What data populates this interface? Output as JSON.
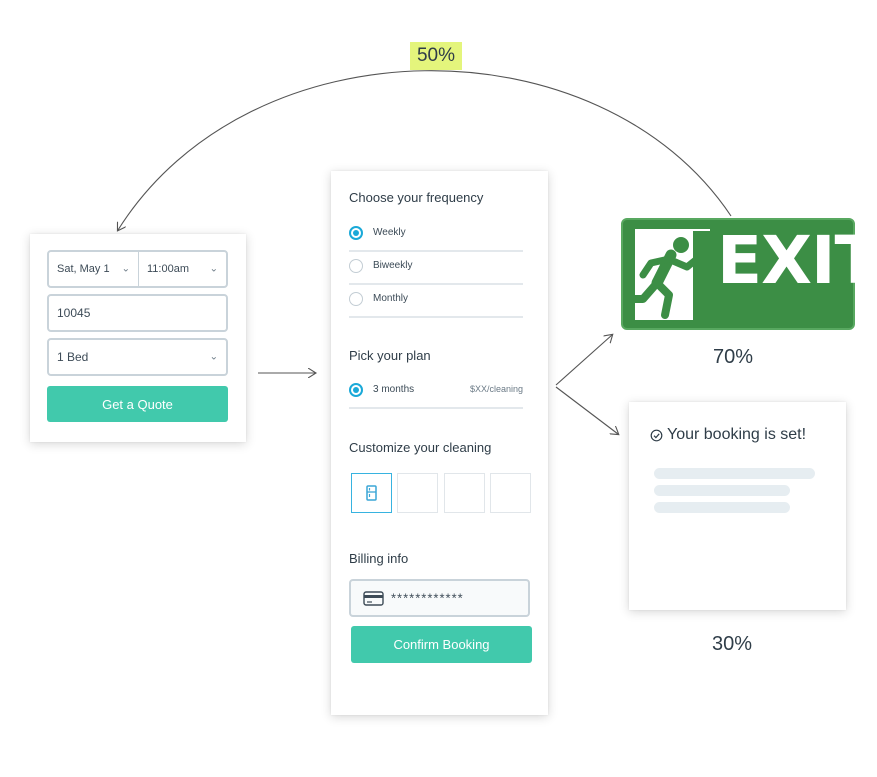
{
  "quote_form": {
    "date": "Sat, May 1",
    "time": "11:00am",
    "zip": "10045",
    "bedrooms": "1 Bed",
    "quote_button": "Get a Quote"
  },
  "booking_form": {
    "frequency_title": "Choose your frequency",
    "frequency_options": [
      "Weekly",
      "Biweekly",
      "Monthly"
    ],
    "selected_frequency": "Weekly",
    "plan_title": "Pick your plan",
    "plan_option": "3 months",
    "plan_price": "$XX/cleaning",
    "customize_title": "Customize your cleaning",
    "billing_title": "Billing info",
    "card_number": "************",
    "confirm_button": "Confirm Booking"
  },
  "outcomes": {
    "loop_percent": "50%",
    "exit_sign_text": "EXIT",
    "exit_percent": "70%",
    "booked_text": "Your booking is set!",
    "booked_percent": "30%"
  },
  "colors": {
    "accent_teal": "#41c9ac",
    "radio_blue": "#1aa9d8",
    "exit_green": "#3c8e45",
    "highlight": "#e4f57c"
  }
}
